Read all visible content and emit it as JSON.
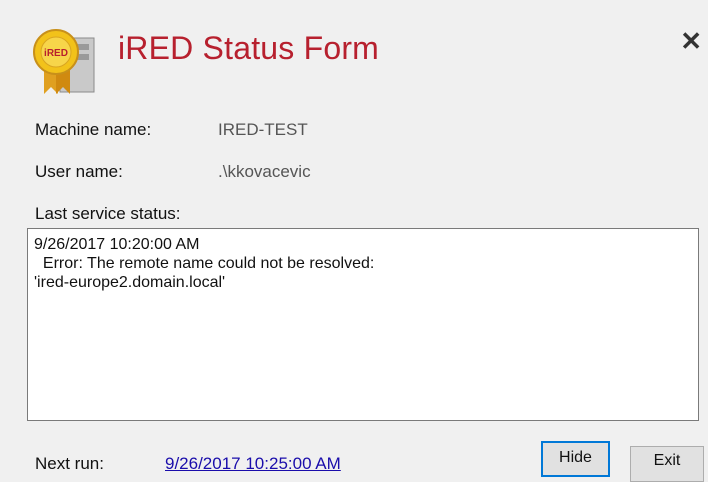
{
  "header": {
    "title": "iRED Status Form",
    "close_glyph": "✕",
    "icon": "ired-certificate-icon",
    "icon_badge_text": "iRED"
  },
  "machine": {
    "label": "Machine name:",
    "value": "IRED-TEST"
  },
  "user": {
    "label": "User name:",
    "value": ".\\kkovacevic"
  },
  "status": {
    "label": "Last service status:",
    "text": "9/26/2017 10:20:00 AM\n  Error: The remote name could not be resolved:\n'ired-europe2.domain.local'"
  },
  "next_run": {
    "label": "Next run:",
    "value": "9/26/2017 10:25:00 AM"
  },
  "buttons": {
    "hide": "Hide",
    "exit": "Exit"
  },
  "colors": {
    "title": "#b7202e",
    "link": "#1a0dab",
    "focus_border": "#0078d7"
  }
}
